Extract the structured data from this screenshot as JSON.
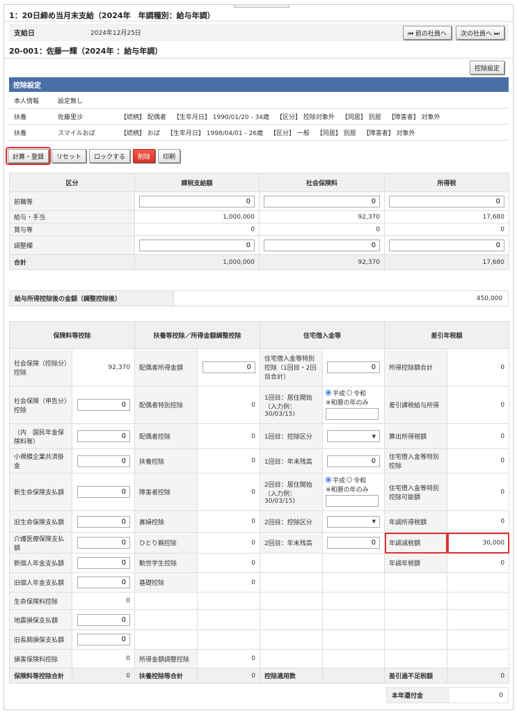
{
  "header": {
    "title": "1：20日締め当月末支給（2024年　年調種別：給与年調）"
  },
  "pay": {
    "label": "支給日",
    "date": "2024年12月25日",
    "prev": "⏮ 前の社員へ",
    "next": "次の社員へ ⏭"
  },
  "employee": {
    "title": "20-001：佐藤一輝（2024年 ：給与年調）"
  },
  "deduct_btn": "控除設定",
  "section": {
    "title": "控除設定"
  },
  "info": [
    {
      "k": "本人情報",
      "v": "設定無し",
      "extra": []
    },
    {
      "k": "扶養",
      "v": "佐藤里沙",
      "extra": [
        "【続柄】 配偶者",
        "【生年月日】 1990/01/20 - 34歳",
        "【区分】 控除対象外",
        "【同居】 別居",
        "【障害者】 対象外"
      ]
    },
    {
      "k": "扶養",
      "v": "スマイルおば",
      "extra": [
        "【続柄】 おば",
        "【生年月日】 1998/04/01 - 26歳",
        "【区分】 一般",
        "【同居】 別居",
        "【障害者】 対象外"
      ]
    }
  ],
  "actions": {
    "calc": "計算・登録",
    "reset": "リセット",
    "lock": "ロックする",
    "delete": "削除",
    "print": "印刷"
  },
  "t1": {
    "headers": [
      "区分",
      "課税支給額",
      "社会保険料",
      "所得税"
    ],
    "rows": [
      {
        "label": "前職等",
        "vals": [
          "0",
          "0",
          "0"
        ],
        "input": true
      },
      {
        "label": "給与・手当",
        "vals": [
          "1,000,000",
          "92,370",
          "17,680"
        ],
        "input": false
      },
      {
        "label": "賞与等",
        "vals": [
          "0",
          "0",
          "0"
        ],
        "input": false
      },
      {
        "label": "調整欄",
        "vals": [
          "0",
          "0",
          "0"
        ],
        "input": true
      },
      {
        "label": "合計",
        "vals": [
          "1,000,000",
          "92,370",
          "17,680"
        ],
        "input": false
      }
    ]
  },
  "kyuyo": {
    "label": "給与所得控除後の金額（調整控除後）",
    "value": "450,000"
  },
  "t2": {
    "headers": [
      "保険料等控除",
      "扶養等控除／所得金額調整控除",
      "住宅借入金等",
      "差引年税額"
    ],
    "c1": [
      {
        "l": "社会保険（控除分）控除",
        "v": "92,370",
        "inp": false
      },
      {
        "l": "社会保険（申告分）控除",
        "v": "0",
        "inp": true
      },
      {
        "l": "（内　国民年金保険料等）",
        "v": "0",
        "inp": true
      },
      {
        "l": "小規模企業共済掛金",
        "v": "0",
        "inp": true
      },
      {
        "l": "新生命保険支払額",
        "v": "0",
        "inp": true
      },
      {
        "l": "旧生命保険支払額",
        "v": "0",
        "inp": true
      },
      {
        "l": "介護医療保険支払額",
        "v": "0",
        "inp": true
      },
      {
        "l": "新個人年金支払額",
        "v": "0",
        "inp": true
      },
      {
        "l": "旧個人年金支払額",
        "v": "0",
        "inp": true
      },
      {
        "l": "生命保険料控除",
        "v": "0",
        "inp": false
      },
      {
        "l": "地震損保支払額",
        "v": "0",
        "inp": true
      },
      {
        "l": "旧長期損保支払額",
        "v": "0",
        "inp": true
      },
      {
        "l": "損害保険料控除",
        "v": "0",
        "inp": false
      },
      {
        "l": "保険料等控除合計",
        "v": "0",
        "inp": false
      }
    ],
    "c2": [
      {
        "l": "配偶者所得金額",
        "v": "0",
        "inp": true
      },
      {
        "l": "配偶者特別控除",
        "v": "0"
      },
      {
        "l": "配偶者控除",
        "v": "0"
      },
      {
        "l": "扶養控除",
        "v": "0"
      },
      {
        "l": "障害者控除",
        "v": "0"
      },
      {
        "l": "寡婦控除",
        "v": "0"
      },
      {
        "l": "ひとり親控除",
        "v": "0"
      },
      {
        "l": "勤労学生控除",
        "v": "0"
      },
      {
        "l": "基礎控除",
        "v": "0"
      },
      {
        "l": "",
        "v": ""
      },
      {
        "l": "",
        "v": ""
      },
      {
        "l": "",
        "v": ""
      },
      {
        "l": "所得金額調整控除",
        "v": "0"
      },
      {
        "l": "扶養控除等合計",
        "v": "0"
      }
    ],
    "c3": [
      {
        "l": "住宅借入金等特別控除（1回目・2回目合計）",
        "v": "0",
        "type": "inp"
      },
      {
        "l": "1回目：居住開始（入力例：30/03/15)",
        "v": "",
        "type": "radio"
      },
      {
        "l": "1回目：控除区分",
        "v": "▼",
        "type": "sel"
      },
      {
        "l": "1回目：年末残高",
        "v": "0",
        "type": "inp"
      },
      {
        "l": "2回目：居住開始（入力例：30/03/15)",
        "v": "",
        "type": "radio"
      },
      {
        "l": "2回目：控除区分",
        "v": "▼",
        "type": "sel"
      },
      {
        "l": "2回目：年末残高",
        "v": "0",
        "type": "inp"
      }
    ],
    "radio": {
      "a": "平成",
      "b": "令和",
      "note": "※和暦の年のみ"
    },
    "sum3": "控除適用数",
    "c4": [
      {
        "l": "所得控除額合計",
        "v": "0"
      },
      {
        "l": "差引課税給与所得",
        "v": "0"
      },
      {
        "l": "算出所得税額",
        "v": "0"
      },
      {
        "l": "住宅借入金等特別控除",
        "v": "0"
      },
      {
        "l": "住宅借入金等特別控除可能額",
        "v": "0"
      },
      {
        "l": "年調所得税額",
        "v": "0"
      },
      {
        "l": "年調減税額",
        "v": "30,000"
      },
      {
        "l": "年調年税額",
        "v": "0"
      },
      {
        "l": "差引過不足税額",
        "v": "0"
      }
    ]
  },
  "refund": {
    "label": "本年還付金",
    "value": "0"
  }
}
